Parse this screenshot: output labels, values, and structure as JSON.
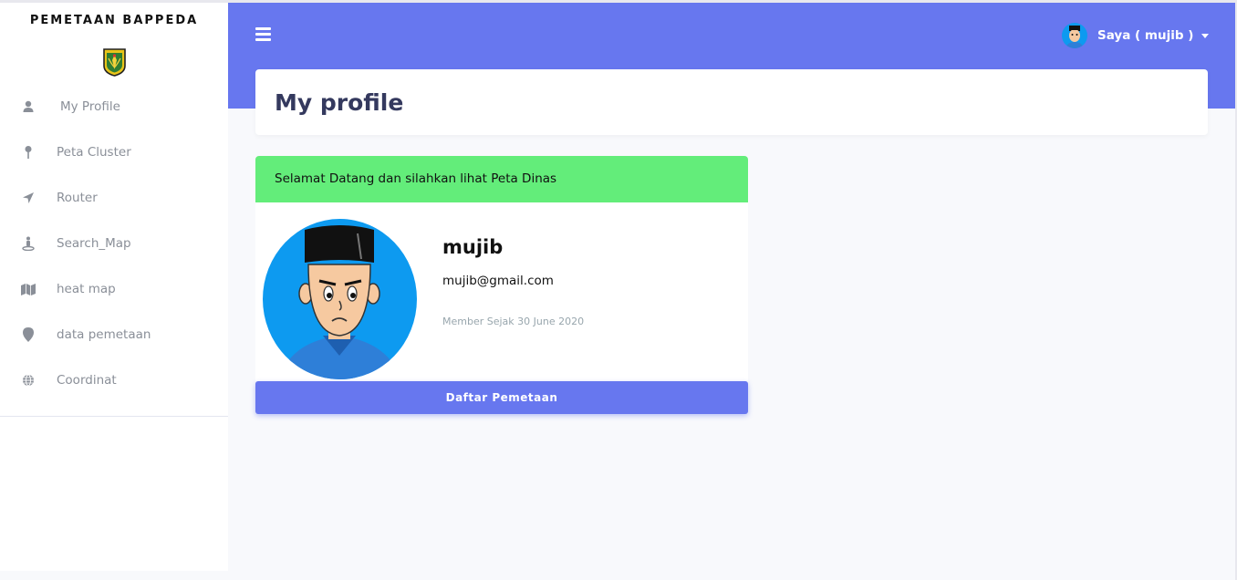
{
  "sidebar": {
    "brand": "PEMETAAN BAPPEDA",
    "logo_icon": "regional-emblem-icon",
    "items": [
      {
        "label": "My Profile",
        "icon": "user-icon"
      },
      {
        "label": "Peta Cluster",
        "icon": "map-pin-icon"
      },
      {
        "label": "Router",
        "icon": "location-arrow-icon"
      },
      {
        "label": "Search_Map",
        "icon": "street-view-icon"
      },
      {
        "label": "heat map",
        "icon": "map-icon"
      },
      {
        "label": "data pemetaan",
        "icon": "map-marker-icon"
      },
      {
        "label": "Coordinat",
        "icon": "globe-icon"
      }
    ]
  },
  "header": {
    "menu_icon": "hamburger-icon",
    "user_label": "Saya ( mujib )"
  },
  "page": {
    "title": "My profile"
  },
  "profile": {
    "alert": "Selamat Datang dan silahkan lihat Peta Dinas",
    "name": "mujib",
    "email": "mujib@gmail.com",
    "member_since": "Member Sejak 30 June 2020",
    "button_label": "Daftar Pemetaan"
  },
  "colors": {
    "primary": "#6777ef",
    "success": "#63ed7a",
    "avatar_bg": "#0d9af0",
    "title": "#34395e",
    "muted": "#98a6ad"
  }
}
